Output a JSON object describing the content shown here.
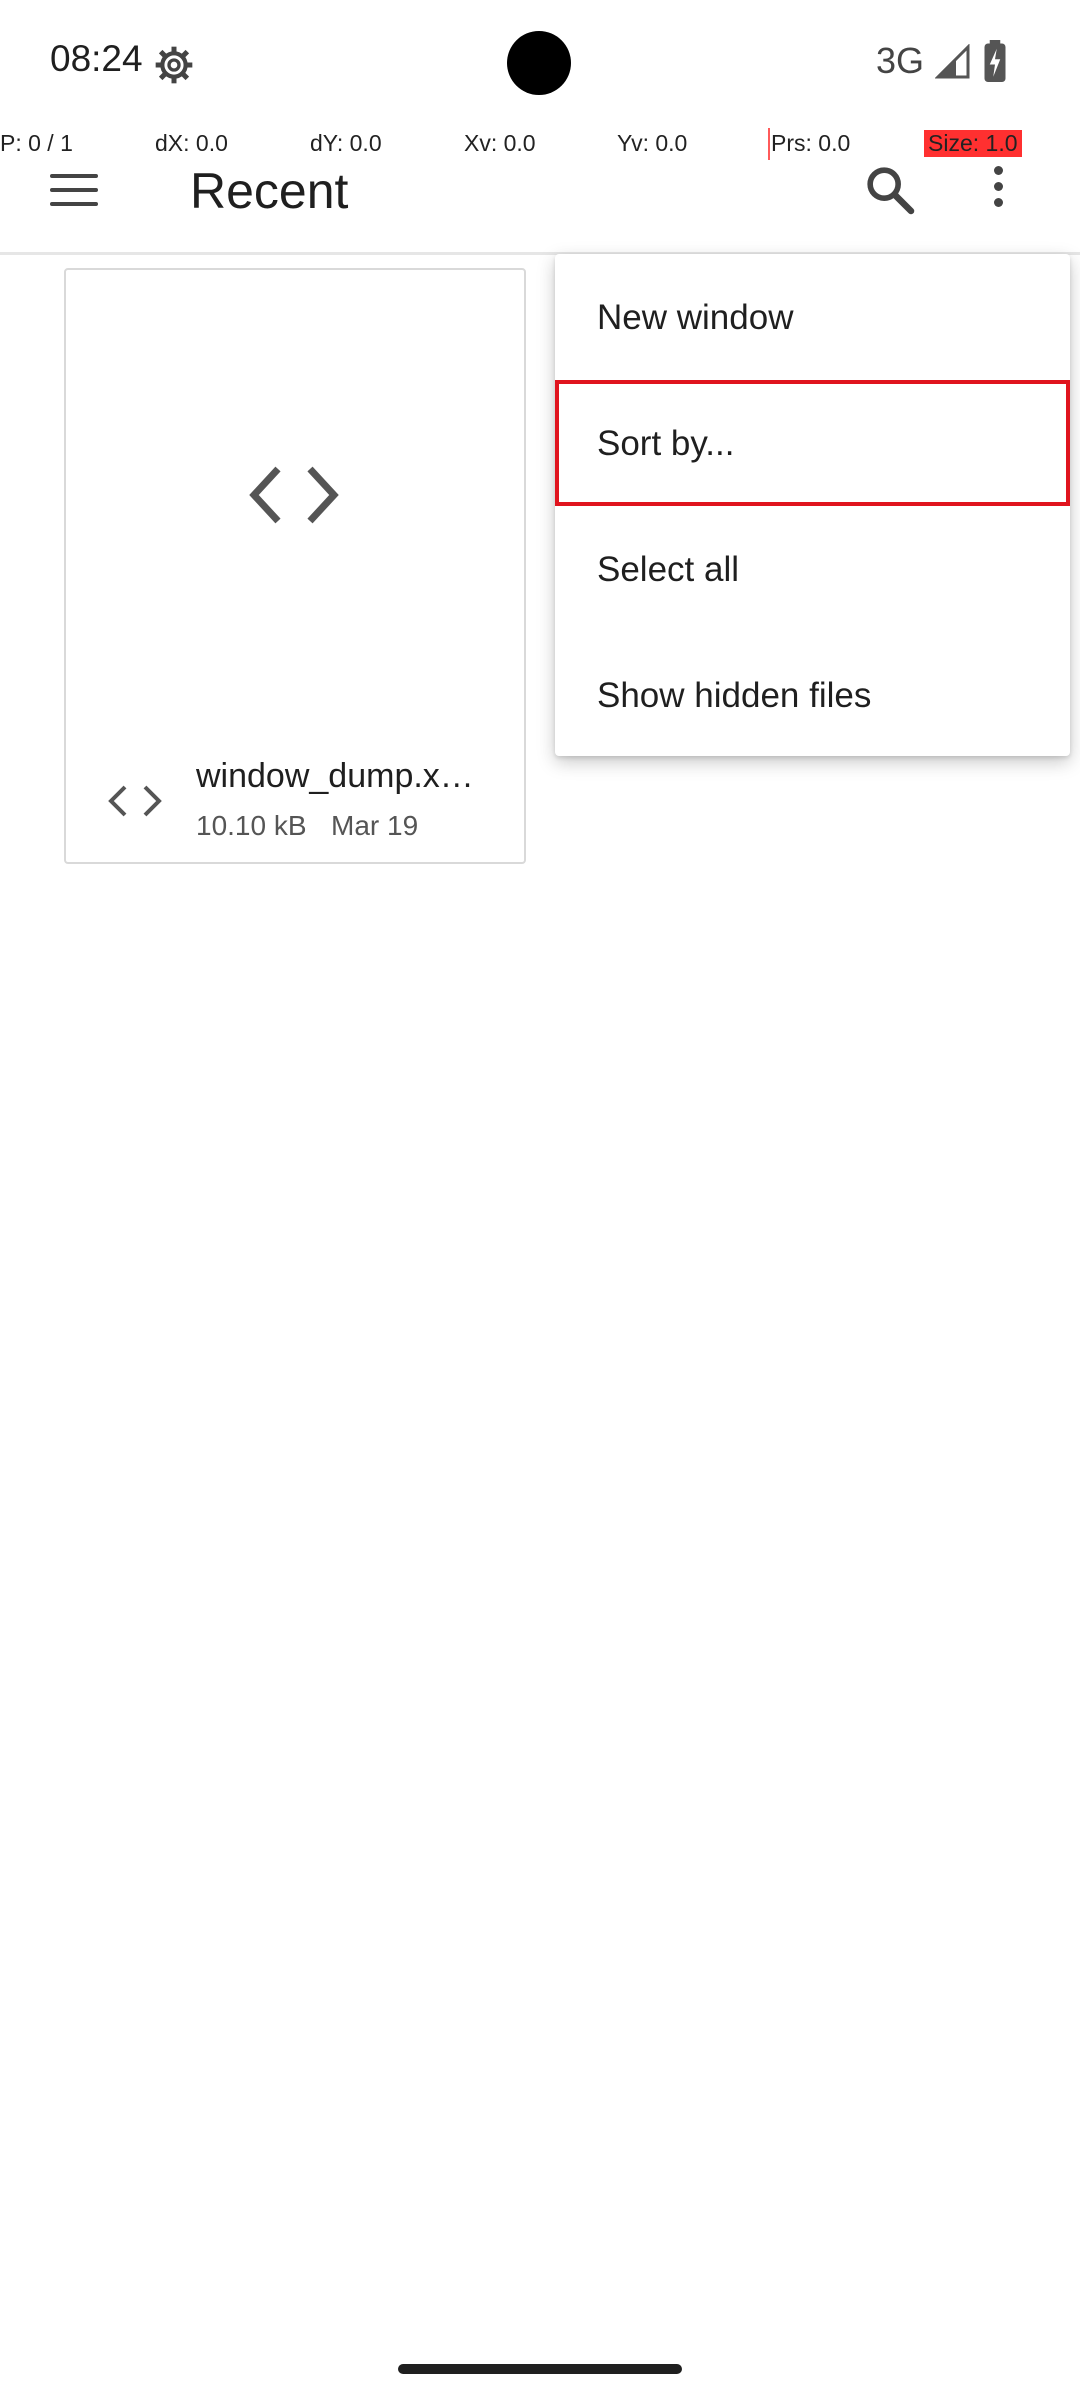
{
  "status_bar": {
    "time": "08:24",
    "network": "3G",
    "icons": [
      "settings-gear-icon",
      "signal-icon",
      "battery-icon"
    ]
  },
  "pointer_overlay": {
    "p": "P: 0 / 1",
    "dx": "dX: 0.0",
    "dy": "dY: 0.0",
    "xv": "Xv: 0.0",
    "yv": "Yv: 0.0",
    "prs": "Prs: 0.0",
    "size": "Size: 1.0"
  },
  "app_bar": {
    "title": "Recent",
    "icons": [
      "hamburger-menu-icon",
      "search-icon",
      "more-vert-icon"
    ]
  },
  "files": [
    {
      "name": "window_dump.x…",
      "size": "10.10 kB",
      "date": "Mar 19",
      "type_icon": "code-icon"
    }
  ],
  "overflow_menu": {
    "items": [
      "New window",
      "Sort by...",
      "Select all",
      "Show hidden files"
    ],
    "highlighted": "Sort by..."
  },
  "colors": {
    "highlight_border": "#e0141e",
    "size_badge": "#ff3030"
  }
}
